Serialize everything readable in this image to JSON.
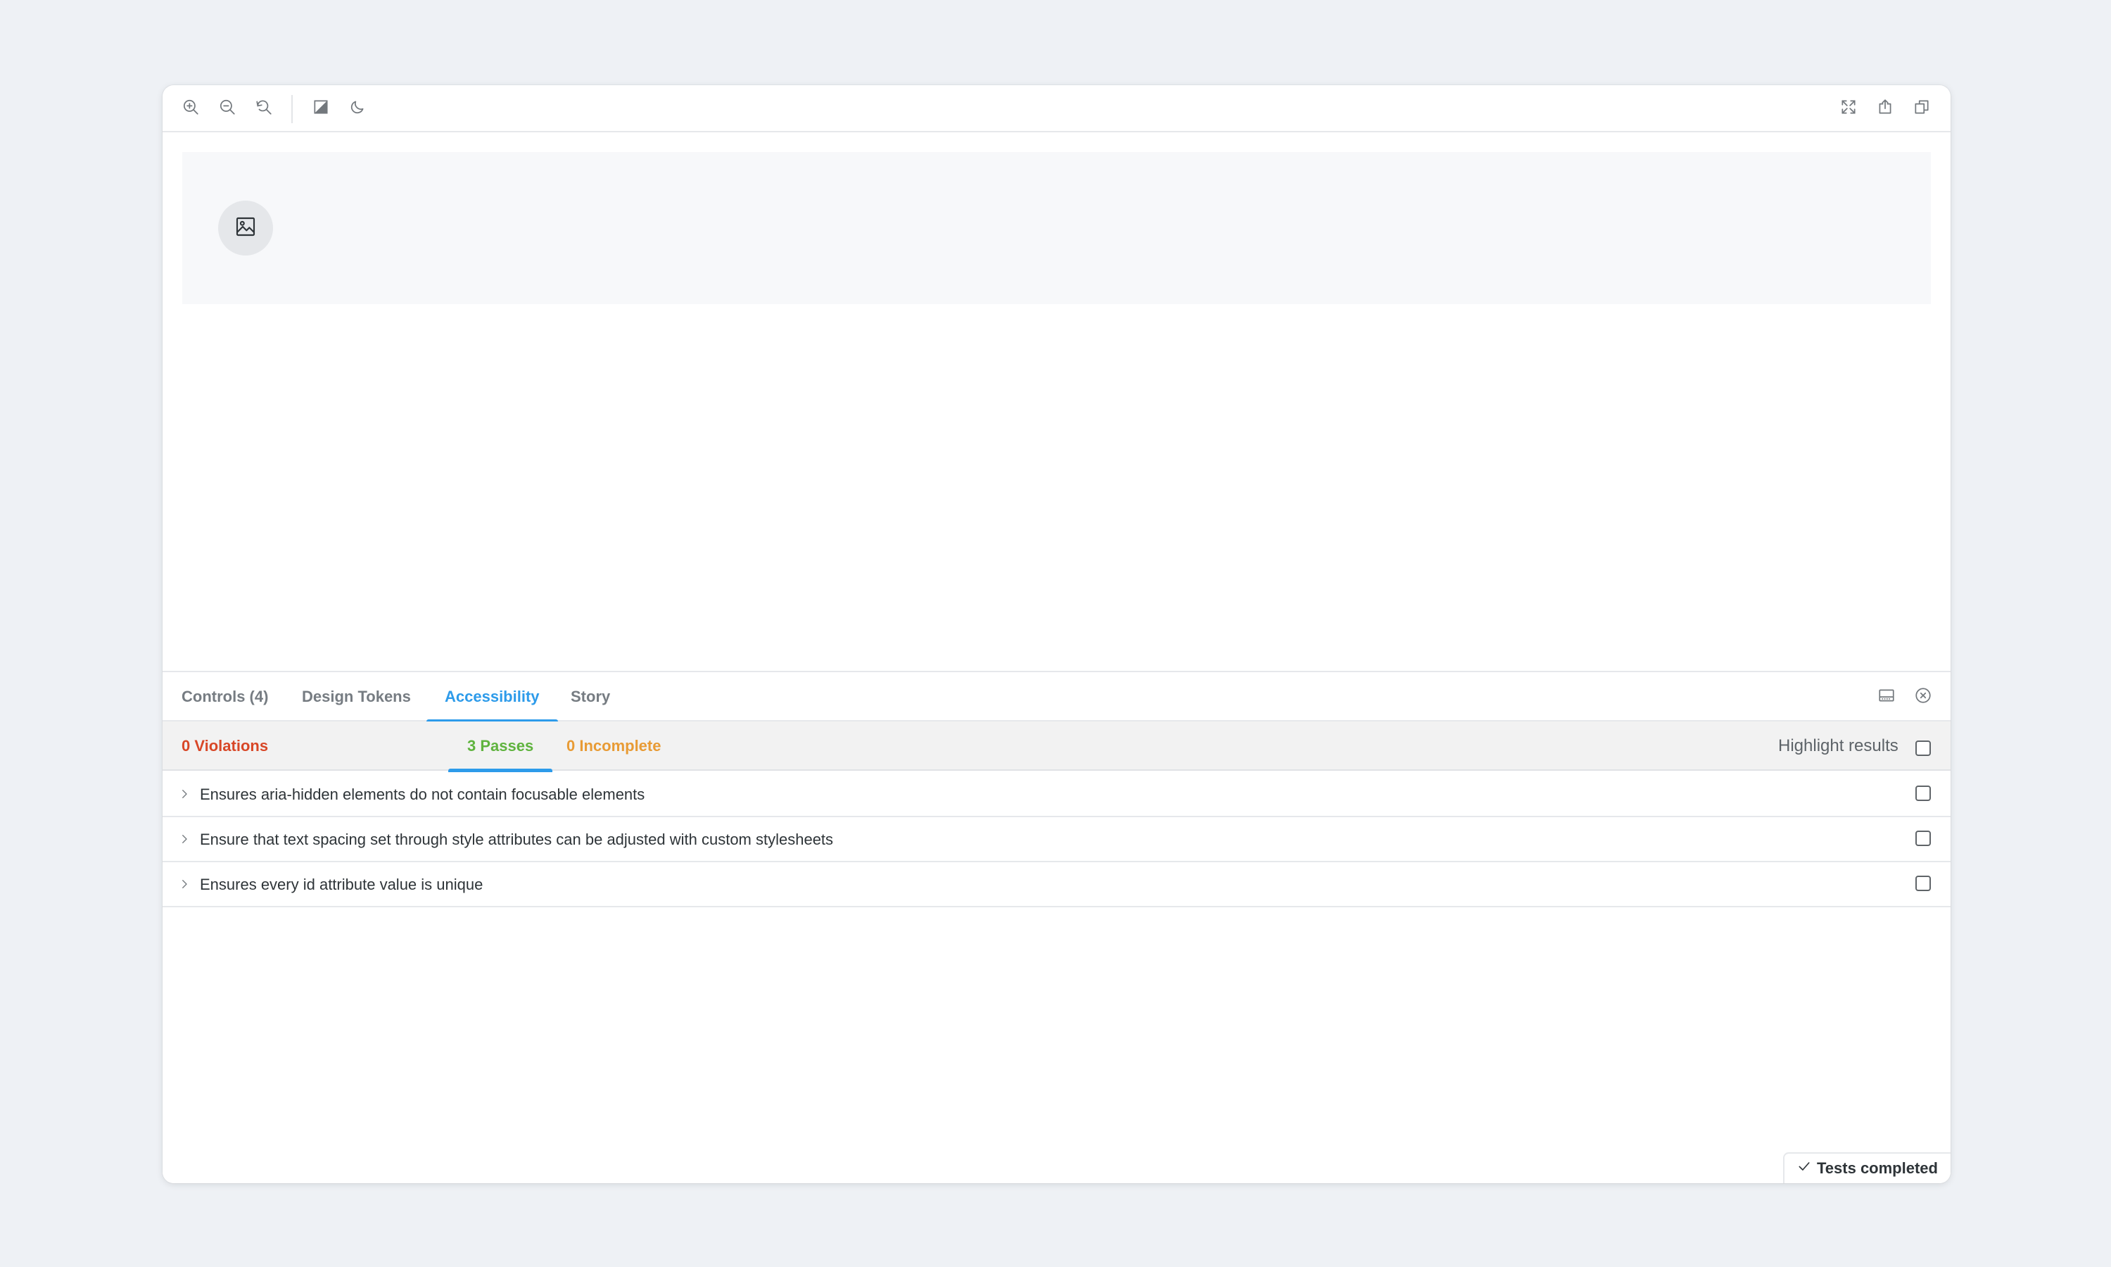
{
  "toolbar": {
    "left_icons": [
      "zoom-in-icon",
      "zoom-out-icon",
      "reset-zoom-icon",
      "contrast-icon",
      "moon-icon"
    ],
    "right_icons": [
      "fullscreen-icon",
      "share-icon",
      "copy-link-icon"
    ]
  },
  "preview": {
    "avatar_icon": "image-icon"
  },
  "panel": {
    "tabs": [
      {
        "label": "Controls (4)",
        "active": false
      },
      {
        "label": "Design Tokens",
        "active": false
      },
      {
        "label": "Accessibility",
        "active": true
      },
      {
        "label": "Story",
        "active": false
      }
    ],
    "icons": [
      "panel-layout-icon",
      "close-circle-icon"
    ]
  },
  "accessibility": {
    "subtabs": [
      {
        "label": "0 Violations",
        "color": "#d84727",
        "active": false
      },
      {
        "label": "3 Passes",
        "color": "#5fb33e",
        "active": true
      },
      {
        "label": "0 Incomplete",
        "color": "#e89b35",
        "active": false
      }
    ],
    "highlight_label": "Highlight results",
    "results": [
      {
        "text": "Ensures aria-hidden elements do not contain focusable elements"
      },
      {
        "text": "Ensure that text spacing set through style attributes can be adjusted with custom stylesheets"
      },
      {
        "text": "Ensures every id attribute value is unique"
      }
    ],
    "status": "Tests completed"
  },
  "colors": {
    "accent": "#2d9bea",
    "background": "#eef1f5",
    "violation": "#d84727",
    "pass": "#5fb33e",
    "incomplete": "#e89b35"
  }
}
